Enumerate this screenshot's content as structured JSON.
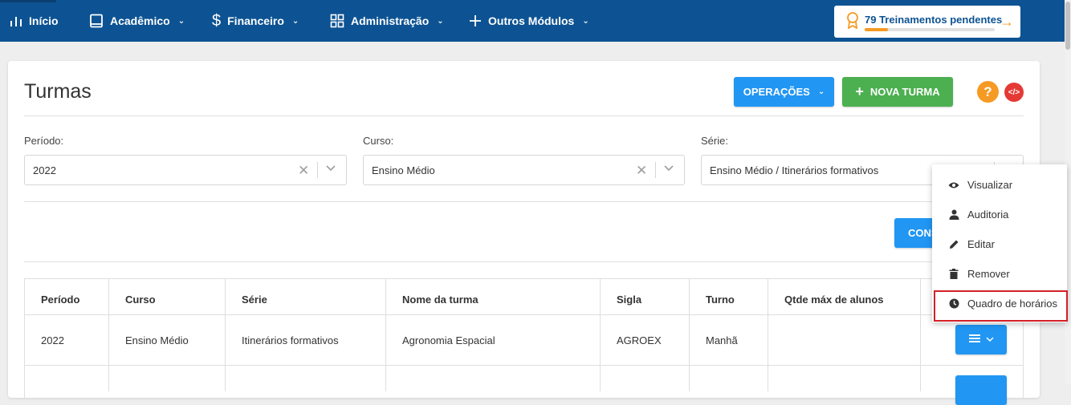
{
  "nav": {
    "items": [
      {
        "label": "Início",
        "icon": "bar-chart-icon",
        "dropdown": false
      },
      {
        "label": "Acadêmico",
        "icon": "book-icon",
        "dropdown": true
      },
      {
        "label": "Financeiro",
        "icon": "dollar-icon",
        "dropdown": true
      },
      {
        "label": "Administração",
        "icon": "grid-icon",
        "dropdown": true
      },
      {
        "label": "Outros Módulos",
        "icon": "plus-icon",
        "dropdown": true
      }
    ],
    "training": {
      "label": "79 Treinamentos pendentes",
      "progress": 0.18,
      "icon": "award-icon"
    }
  },
  "page": {
    "title": "Turmas",
    "operations_label": "OPERAÇÕES",
    "new_label": "NOVA TURMA",
    "help_label": "?",
    "code_label": "</>",
    "consult_label": "CONS"
  },
  "filters": {
    "period": {
      "label": "Período:",
      "value": "2022"
    },
    "course": {
      "label": "Curso:",
      "value": "Ensino Médio"
    },
    "grade": {
      "label": "Série:",
      "value": "Ensino Médio / Itinerários formativos"
    }
  },
  "table": {
    "headers": [
      "Período",
      "Curso",
      "Série",
      "Nome da turma",
      "Sigla",
      "Turno",
      "Qtde máx de alunos"
    ],
    "rows": [
      [
        "2022",
        "Ensino Médio",
        "Itinerários formativos",
        "Agronomia Espacial",
        "AGROEX",
        "Manhã",
        ""
      ]
    ]
  },
  "menu": {
    "items": [
      {
        "label": "Visualizar",
        "icon": "eye-icon"
      },
      {
        "label": "Auditoria",
        "icon": "user-icon"
      },
      {
        "label": "Editar",
        "icon": "pencil-icon"
      },
      {
        "label": "Remover",
        "icon": "trash-icon"
      },
      {
        "label": "Quadro de horários",
        "icon": "clock-icon"
      }
    ],
    "highlighted_index": 4
  },
  "colors": {
    "nav_bg": "#0d5393",
    "primary": "#2196f3",
    "success": "#4caf50",
    "warning": "#f59a23",
    "danger": "#e53935",
    "highlight": "#d32027"
  }
}
